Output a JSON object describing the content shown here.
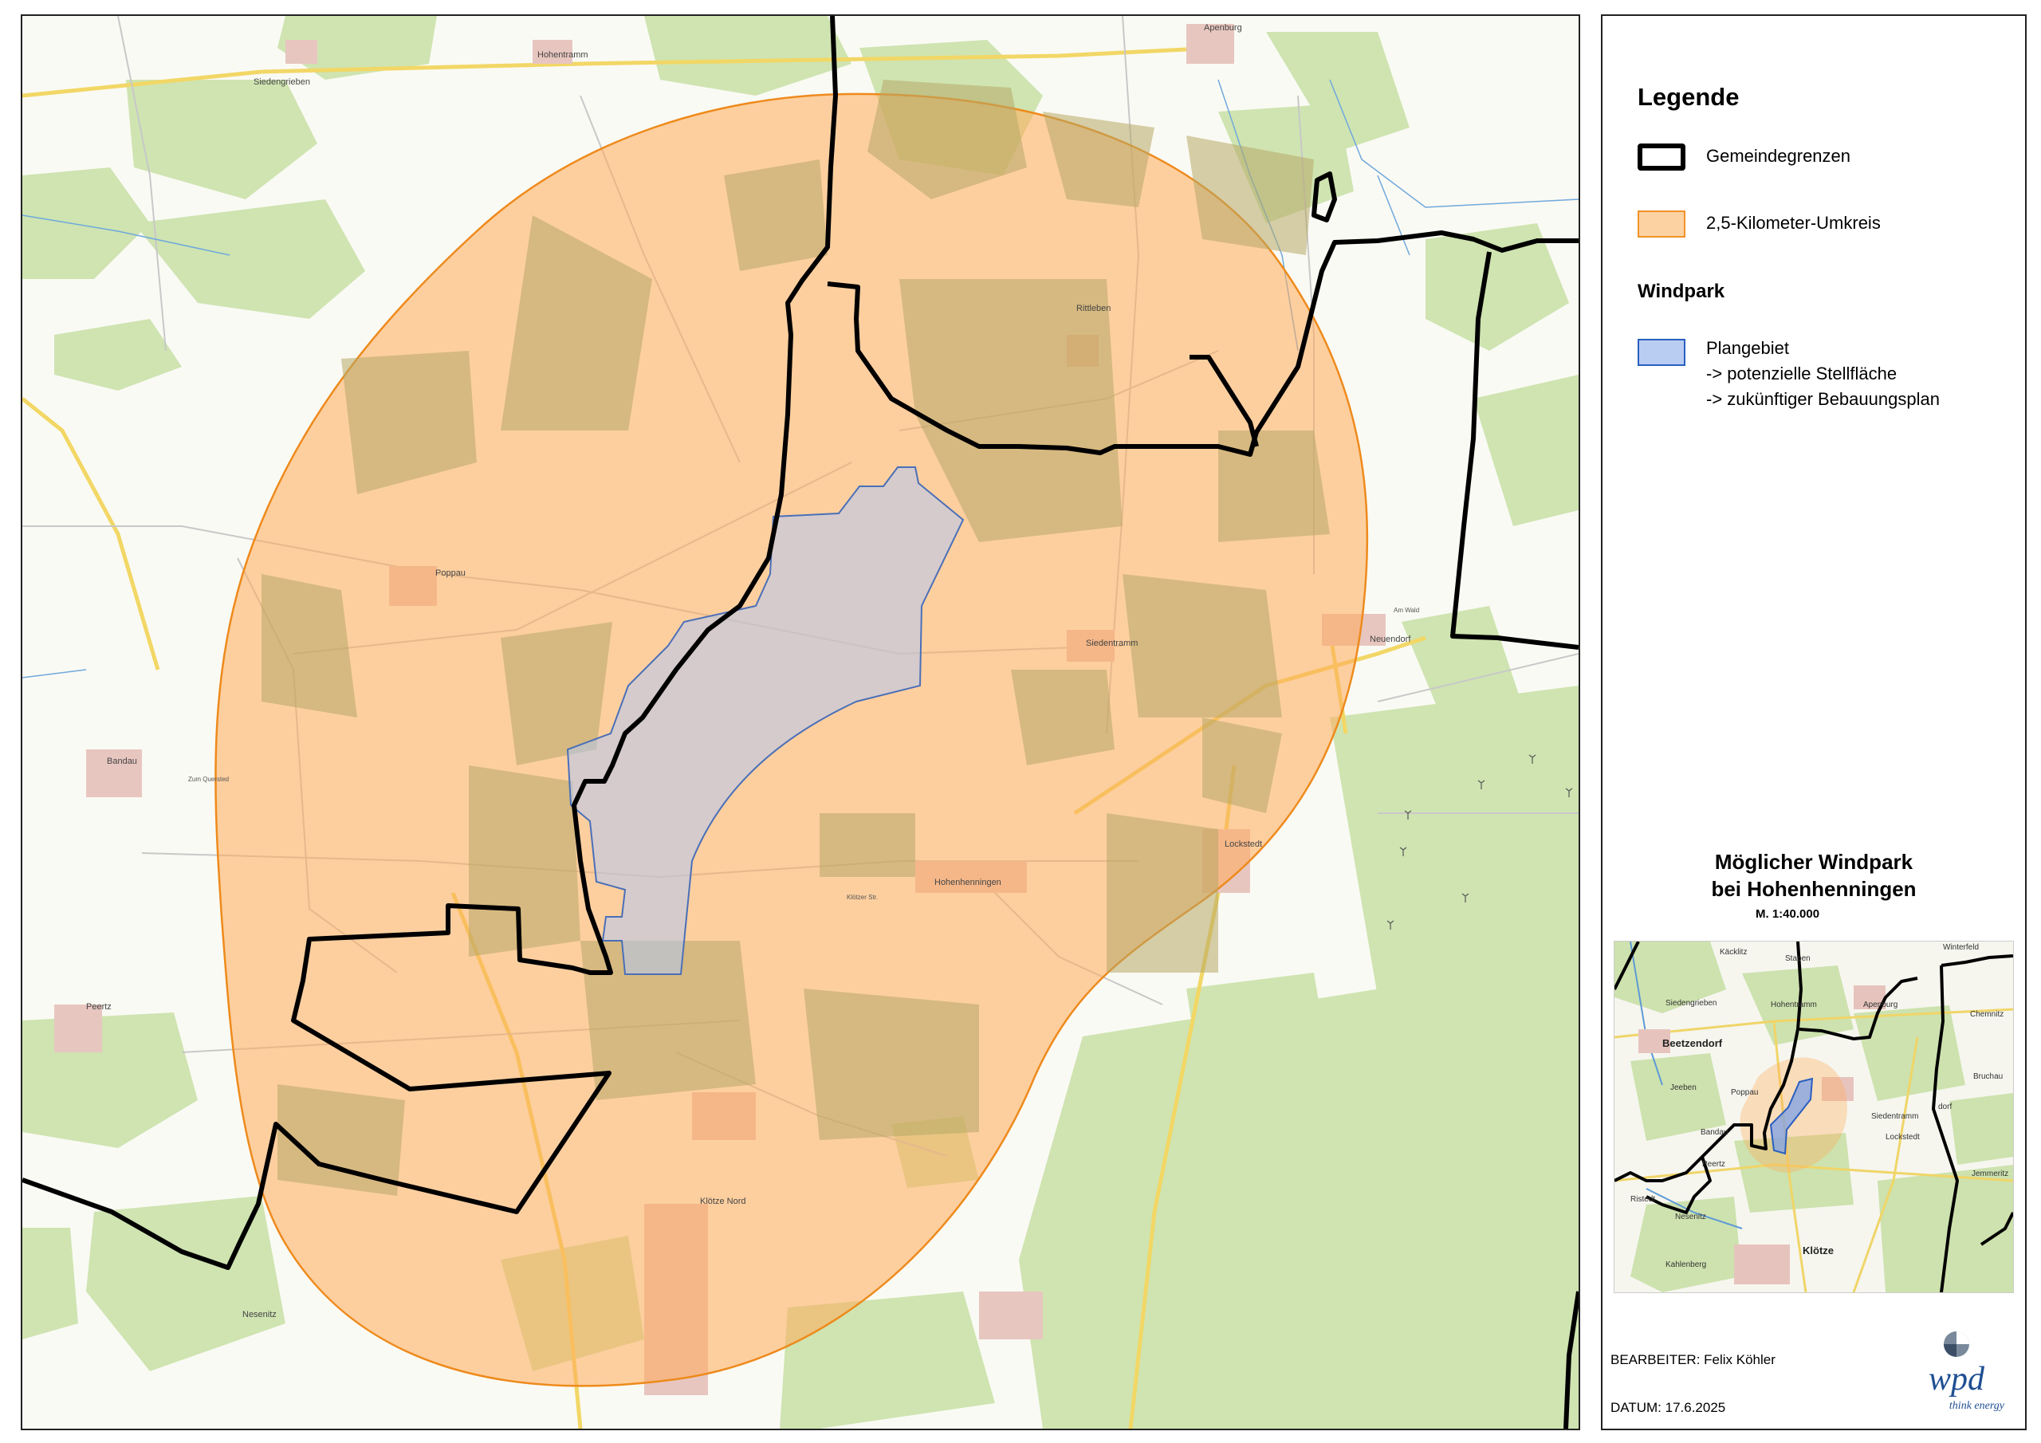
{
  "legend": {
    "title": "Legende",
    "boundary_label": "Gemeindegrenzen",
    "circle_label": "2,5-Kilometer-Umkreis",
    "windpark_heading": "Windpark",
    "plan_label_1": "Plangebiet",
    "plan_label_2": "-> potenzielle Stellfläche",
    "plan_label_3": "-> zukünftiger Bebauungsplan",
    "colors": {
      "boundary": "#000000",
      "circle_fill": "#fdd2a3",
      "circle_stroke": "#f0922a",
      "plan_fill": "#b9cdf2",
      "plan_stroke": "#2a5fbf"
    }
  },
  "map_title": {
    "line1": "Möglicher Windpark",
    "line2": "bei Hohenhenningen"
  },
  "scale": "M.  1:40.000",
  "places": {
    "hohentramm": "Hohentramm",
    "siedengrieben": "Siedengrieben",
    "apenburg": "Apenburg",
    "rittleben": "Rittleben",
    "poppau": "Poppau",
    "siedentramm": "Siedentramm",
    "neuendorf": "Neuendorf",
    "bandau": "Bandau",
    "lockstedt": "Lockstedt",
    "hohenhenningen": "Hohenhenningen",
    "peertz": "Peertz",
    "kloetze_nord": "Klötze Nord",
    "nesenitz": "Nesenitz"
  },
  "road_labels": {
    "zum_quersted": "Zum Quersted",
    "am_wald": "Am Wald",
    "klotzer_str": "Klötzer Str."
  },
  "overview": {
    "places": {
      "winterfeld": "Winterfeld",
      "kaecklitz": "Käcklitz",
      "stapen": "Stapen",
      "siedengrieben": "Siedengrieben",
      "hohentramm": "Hohentramm",
      "apenburg": "Apenburg",
      "chemnitz": "Chemnitz",
      "beetzendorf": "Beetzendorf",
      "bruchau": "Bruchau",
      "jeeben": "Jeeben",
      "poppau": "Poppau",
      "siedentramm": "Siedentramm",
      "dorf": "dorf",
      "bandau": "Bandau",
      "lockstedt": "Lockstedt",
      "peertz": "Peertz",
      "jemmeritz": "Jemmeritz",
      "ristedt": "Ristedt",
      "nesenitz": "Nesenitz",
      "kahlenberg": "Kahlenberg",
      "kloetze": "Klötze"
    }
  },
  "footer": {
    "editor": "BEARBEITER: Felix Köhler",
    "date": "DATUM: 17.6.2025"
  },
  "logo": {
    "word": "wpd",
    "tagline": "think energy"
  }
}
